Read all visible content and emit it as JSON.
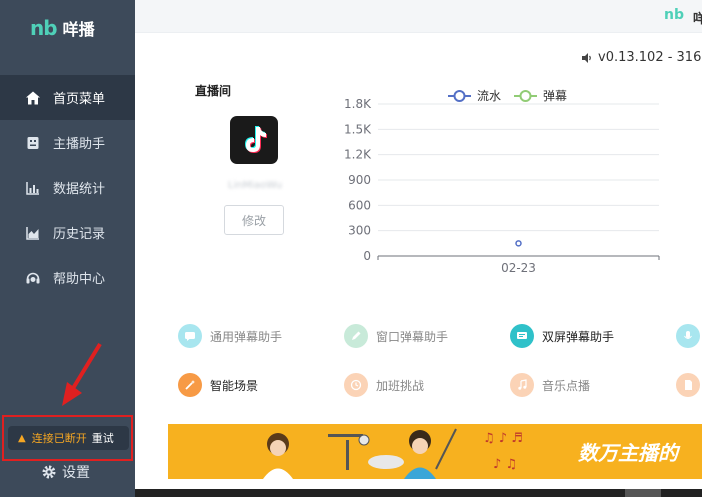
{
  "brand": {
    "logo": "nb",
    "name": "咩播"
  },
  "nav": [
    {
      "label": "首页菜单",
      "icon": "home-icon",
      "active": true
    },
    {
      "label": "主播助手",
      "icon": "robot-icon",
      "active": false
    },
    {
      "label": "数据统计",
      "icon": "bar-chart-icon",
      "active": false
    },
    {
      "label": "历史记录",
      "icon": "area-chart-icon",
      "active": false
    },
    {
      "label": "帮助中心",
      "icon": "headset-icon",
      "active": false
    }
  ],
  "connection": {
    "status": "连接已断开",
    "retry": "重试",
    "color": "#f5a623"
  },
  "settings": {
    "label": "设置"
  },
  "header": {
    "logo": "nb",
    "name": "咩"
  },
  "version": "v0.13.102 - 316",
  "room": {
    "label": "直播间",
    "username": "LinMiaoWu",
    "edit_label": "修改",
    "platform_icon": "tiktok-icon"
  },
  "chart_data": {
    "type": "line",
    "series": [
      {
        "name": "流水",
        "color": "#5470c6",
        "values": [
          150
        ]
      },
      {
        "name": "弹幕",
        "color": "#91cc75",
        "values": [
          null
        ]
      }
    ],
    "categories": [
      "02-23"
    ],
    "y_ticks": [
      "0",
      "300",
      "600",
      "900",
      "1.2K",
      "1.5K",
      "1.8K"
    ],
    "ylim": [
      0,
      1800
    ],
    "grid": true,
    "legend_position": "top-center"
  },
  "tools": [
    {
      "label": "通用弹幕助手",
      "icon": "chat-icon",
      "color": "#a8e6ef",
      "active": false
    },
    {
      "label": "窗口弹幕助手",
      "icon": "pen-icon",
      "color": "#c8ead9",
      "active": false
    },
    {
      "label": "双屏弹幕助手",
      "icon": "screen-icon",
      "color": "#2fc1c9",
      "active": true
    },
    {
      "label": "",
      "icon": "mic-icon",
      "color": "#a8e6ef",
      "active": false
    },
    {
      "label": "智能场景",
      "icon": "magic-wand-icon",
      "color": "#f79a45",
      "active": true
    },
    {
      "label": "加班挑战",
      "icon": "clock-icon",
      "color": "#fbd3b6",
      "active": false
    },
    {
      "label": "音乐点播",
      "icon": "music-icon",
      "color": "#fbd3b6",
      "active": false
    },
    {
      "label": "",
      "icon": "music-file-icon",
      "color": "#fbd3b6",
      "active": false
    }
  ],
  "banner": {
    "slogan": "数万主播的"
  }
}
